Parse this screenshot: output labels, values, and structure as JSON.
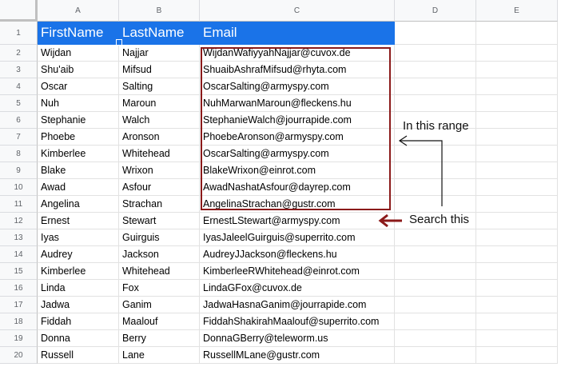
{
  "columns": [
    "A",
    "B",
    "C",
    "D",
    "E"
  ],
  "rows": [
    "1",
    "2",
    "3",
    "4",
    "5",
    "6",
    "7",
    "8",
    "9",
    "10",
    "11",
    "12",
    "13",
    "14",
    "15",
    "16",
    "17",
    "18",
    "19",
    "20"
  ],
  "headers": [
    "FirstName",
    "LastName",
    "Email"
  ],
  "data": [
    [
      "Wijdan",
      "Najjar",
      "WijdanWafiyyahNajjar@cuvox.de"
    ],
    [
      "Shu'aib",
      "Mifsud",
      "ShuaibAshrafMifsud@rhyta.com"
    ],
    [
      "Oscar",
      "Salting",
      "OscarSalting@armyspy.com"
    ],
    [
      "Nuh",
      "Maroun",
      "NuhMarwanMaroun@fleckens.hu"
    ],
    [
      "Stephanie",
      "Walch",
      "StephanieWalch@jourrapide.com"
    ],
    [
      "Phoebe",
      "Aronson",
      "PhoebeAronson@armyspy.com"
    ],
    [
      "Kimberlee",
      "Whitehead",
      "OscarSalting@armyspy.com"
    ],
    [
      "Blake",
      "Wrixon",
      "BlakeWrixon@einrot.com"
    ],
    [
      "Awad",
      "Asfour",
      "AwadNashatAsfour@dayrep.com"
    ],
    [
      "Angelina",
      "Strachan",
      "AngelinaStrachan@gustr.com"
    ],
    [
      "Ernest",
      "Stewart",
      "ErnestLStewart@armyspy.com"
    ],
    [
      "Iyas",
      "Guirguis",
      "IyasJaleelGuirguis@superrito.com"
    ],
    [
      "Audrey",
      "Jackson",
      "AudreyJJackson@fleckens.hu"
    ],
    [
      "Kimberlee",
      "Whitehead",
      "KimberleeRWhitehead@einrot.com"
    ],
    [
      "Linda",
      "Fox",
      "LindaGFox@cuvox.de"
    ],
    [
      "Jadwa",
      "Ganim",
      "JadwaHasnaGanim@jourrapide.com"
    ],
    [
      "Fiddah",
      "Maalouf",
      "FiddahShakirahMaalouf@superrito.com"
    ],
    [
      "Donna",
      "Berry",
      "DonnaGBerry@teleworm.us"
    ],
    [
      "Russell",
      "Lane",
      "RussellMLane@gustr.com"
    ]
  ],
  "annotations": {
    "range_label": "In this range",
    "search_label": "Search this"
  },
  "colors": {
    "header_fill": "#1a73e8",
    "annotation_box": "#8b1a1a"
  }
}
